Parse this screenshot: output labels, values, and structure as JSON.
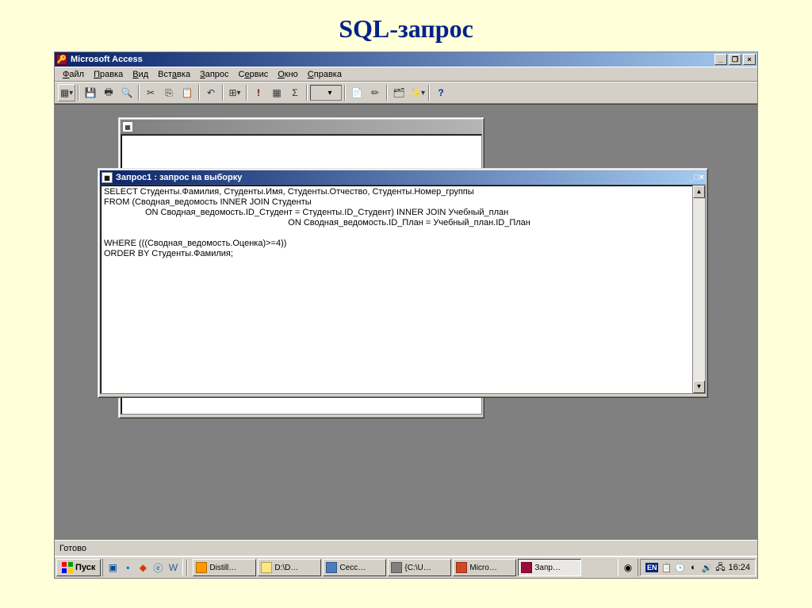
{
  "slide": {
    "title": "SQL-запрос"
  },
  "app": {
    "title": "Microsoft Access",
    "menu": [
      "Файл",
      "Правка",
      "Вид",
      "Вставка",
      "Запрос",
      "Сервис",
      "Окно",
      "Справка"
    ],
    "status": "Готово"
  },
  "child_window": {
    "title": "Запрос1 : запрос на выборку",
    "sql": "SELECT Студенты.Фамилия, Студенты.Имя, Студенты.Отчество, Студенты.Номер_группы\nFROM (Сводная_ведомость INNER JOIN Студенты\n                 ON Сводная_ведомость.ID_Студент = Студенты.ID_Студент) INNER JOIN Учебный_план\n                                                                            ON Сводная_ведомость.ID_План = Учебный_план.ID_План\n\nWHERE (((Сводная_ведомость.Оценка)>=4))\nORDER BY Студенты.Фамилия;"
  },
  "taskbar": {
    "start": "Пуск",
    "tasks": [
      {
        "label": "Distill…",
        "iconColor": "#ff9900"
      },
      {
        "label": "D:\\D…",
        "iconColor": "#ffe680"
      },
      {
        "label": "Сесс…",
        "iconColor": "#4a7ebb"
      },
      {
        "label": "{C:\\U…",
        "iconColor": "#808080"
      },
      {
        "label": "Micro…",
        "iconColor": "#d24726"
      },
      {
        "label": "Запр…",
        "iconColor": "#9a0b3b",
        "pressed": true
      }
    ],
    "lang": "EN",
    "time": "16:24"
  }
}
